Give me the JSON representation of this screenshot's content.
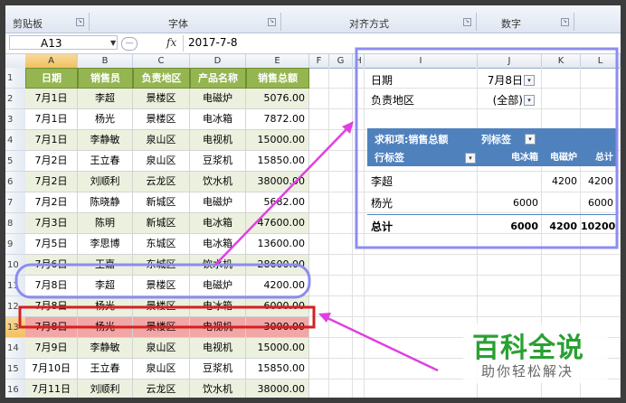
{
  "ribbon": {
    "groups": [
      "剪贴板",
      "字体",
      "对齐方式",
      "数字"
    ]
  },
  "formula_bar": {
    "name_box": "A13",
    "fx": "fx",
    "value": "2017-7-8"
  },
  "columns": [
    "A",
    "B",
    "C",
    "D",
    "E",
    "F",
    "G",
    "H",
    "I",
    "J",
    "K",
    "L"
  ],
  "rows": [
    "1",
    "2",
    "3",
    "4",
    "5",
    "6",
    "7",
    "8",
    "9",
    "10",
    "11",
    "12",
    "13",
    "14",
    "15",
    "16"
  ],
  "table": {
    "headers": [
      "日期",
      "销售员",
      "负责地区",
      "产品名称",
      "销售总额"
    ],
    "rows": [
      [
        "7月1日",
        "李超",
        "景楼区",
        "电磁炉",
        "5076.00"
      ],
      [
        "7月1日",
        "杨光",
        "景楼区",
        "电冰箱",
        "7872.00"
      ],
      [
        "7月1日",
        "李静敏",
        "泉山区",
        "电视机",
        "15000.00"
      ],
      [
        "7月2日",
        "王立春",
        "泉山区",
        "豆浆机",
        "15850.00"
      ],
      [
        "7月2日",
        "刘顺利",
        "云龙区",
        "饮水机",
        "38000.00"
      ],
      [
        "7月2日",
        "陈晓静",
        "新城区",
        "电磁炉",
        "5682.00"
      ],
      [
        "7月3日",
        "陈明",
        "新城区",
        "电冰箱",
        "47600.00"
      ],
      [
        "7月5日",
        "李思博",
        "东城区",
        "电冰箱",
        "13600.00"
      ],
      [
        "7月6日",
        "王嘉",
        "东城区",
        "饮水机",
        "28600.00"
      ],
      [
        "7月8日",
        "李超",
        "景楼区",
        "电磁炉",
        "4200.00"
      ],
      [
        "7月8日",
        "杨光",
        "景楼区",
        "电冰箱",
        "6000.00"
      ],
      [
        "7月8日",
        "杨光",
        "景楼区",
        "电视机",
        "3000.00"
      ],
      [
        "7月9日",
        "李静敏",
        "泉山区",
        "电视机",
        "15000.00"
      ],
      [
        "7月10日",
        "王立春",
        "泉山区",
        "豆浆机",
        "15850.00"
      ],
      [
        "7月11日",
        "刘顺利",
        "云龙区",
        "饮水机",
        "38000.00"
      ]
    ]
  },
  "pivot": {
    "filters": [
      {
        "label": "日期",
        "value": "7月8日"
      },
      {
        "label": "负责地区",
        "value": "(全部)"
      }
    ],
    "value_header": "求和项:销售总额",
    "col_label": "列标签",
    "row_label": "行标签",
    "col_items": [
      "电冰箱",
      "电磁炉",
      "总计"
    ],
    "rows": [
      {
        "name": "李超",
        "values": [
          "",
          "4200",
          "4200"
        ]
      },
      {
        "name": "杨光",
        "values": [
          "6000",
          "",
          "6000"
        ]
      }
    ],
    "total": {
      "name": "总计",
      "values": [
        "6000",
        "4200",
        "10200"
      ]
    }
  },
  "annotation_colors": {
    "purple_box": "#8d8cf0",
    "red_box": "#d42020",
    "arrow": "#e040e0"
  },
  "watermark": {
    "title": "百科全说",
    "subtitle": "助你轻松解决"
  }
}
